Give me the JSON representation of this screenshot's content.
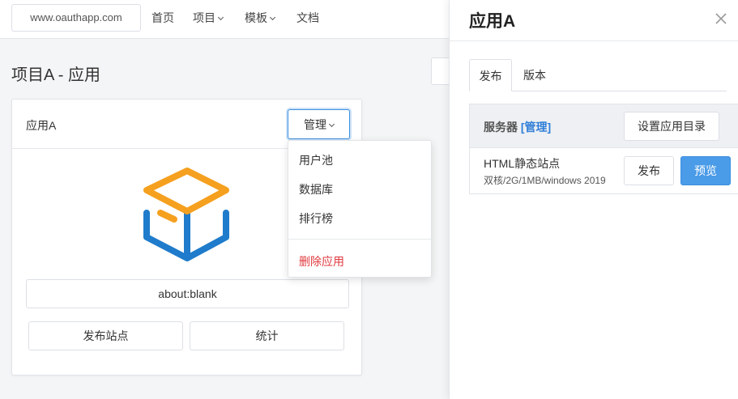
{
  "topbar": {
    "url": "www.oauthapp.com",
    "nav": [
      {
        "label": "首页"
      },
      {
        "label": "项目"
      },
      {
        "label": "模板"
      },
      {
        "label": "文档"
      }
    ]
  },
  "page": {
    "title": "项目A - 应用"
  },
  "app_card": {
    "title": "应用A",
    "manage_label": "管理",
    "url_value": "about:blank",
    "publish_site_label": "发布站点",
    "stats_label": "统计"
  },
  "dropdown": {
    "items": [
      {
        "label": "用户池"
      },
      {
        "label": "数据库"
      },
      {
        "label": "排行榜"
      }
    ],
    "danger_item": "删除应用"
  },
  "drawer": {
    "title": "应用A",
    "tabs": [
      {
        "label": "发布",
        "active": true
      },
      {
        "label": "版本",
        "active": false
      }
    ],
    "servers": {
      "header_label": "服务器",
      "header_link": "[管理]",
      "set_dir_label": "设置应用目录",
      "rows": [
        {
          "name": "HTML静态站点",
          "spec": "双核/2G/1MB/windows 2019",
          "publish_label": "发布",
          "preview_label": "预览"
        }
      ]
    }
  },
  "colors": {
    "accent": "#2f7ed8",
    "primary_button": "#4a9be8",
    "danger": "#e0393e",
    "icon_orange": "#f5a01f",
    "icon_blue": "#1f7bcb"
  }
}
